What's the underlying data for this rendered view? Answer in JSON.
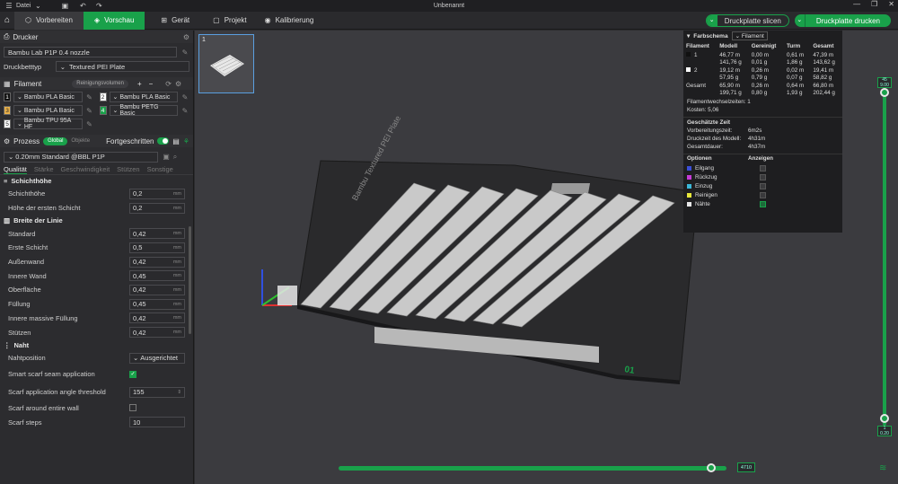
{
  "titlebar": {
    "file_menu": "Datei",
    "title": "Unbenannt"
  },
  "toolbar": {
    "tab_prepare": "Vorbereiten",
    "tab_preview": "Vorschau",
    "device": "Gerät",
    "project": "Projekt",
    "calibration": "Kalibrierung",
    "slice_plate": "Druckplatte slicen",
    "print_plate": "Druckplatte drucken"
  },
  "printer": {
    "section": "Drucker",
    "name": "Bambu Lab P1P 0.4 nozzle",
    "bed_label": "Druckbetttyp",
    "bed_value": "Textured PEI Plate"
  },
  "filament": {
    "section": "Filament",
    "cleaning_volume": "Reinigungsvolumen",
    "items": [
      {
        "num": "1",
        "name": "Bambu PLA Basic",
        "color": "#111111"
      },
      {
        "num": "2",
        "name": "Bambu PLA Basic",
        "color": "#ffffff"
      },
      {
        "num": "3",
        "name": "Bambu PLA Basic",
        "color": "#e8b04a"
      },
      {
        "num": "4",
        "name": "Bambu PETG Basic",
        "color": "#19a14a"
      },
      {
        "num": "5",
        "name": "Bambu TPU 95A HF",
        "color": "#ffffff"
      }
    ]
  },
  "process": {
    "section": "Prozess",
    "toggle_global": "Global",
    "toggle_objects": "Objekte",
    "advanced": "Fortgeschritten",
    "preset": "0.20mm Standard @BBL P1P",
    "tabs": [
      "Qualität",
      "Stärke",
      "Geschwindigkeit",
      "Stützen",
      "Sonstige"
    ],
    "group_layer": "Schichthöhe",
    "layer_params": [
      {
        "label": "Schichthöhe",
        "value": "0,2",
        "unit": "mm"
      },
      {
        "label": "Höhe der ersten Schicht",
        "value": "0,2",
        "unit": "mm"
      }
    ],
    "group_width": "Breite der Linie",
    "width_params": [
      {
        "label": "Standard",
        "value": "0,42",
        "unit": "mm"
      },
      {
        "label": "Erste Schicht",
        "value": "0,5",
        "unit": "mm"
      },
      {
        "label": "Außenwand",
        "value": "0,42",
        "unit": "mm"
      },
      {
        "label": "Innere Wand",
        "value": "0,45",
        "unit": "mm"
      },
      {
        "label": "Oberfläche",
        "value": "0,42",
        "unit": "mm"
      },
      {
        "label": "Füllung",
        "value": "0,45",
        "unit": "mm"
      },
      {
        "label": "Innere massive Füllung",
        "value": "0,42",
        "unit": "mm"
      },
      {
        "label": "Stützen",
        "value": "0,42",
        "unit": "mm"
      }
    ],
    "group_seam": "Naht",
    "seam_position_label": "Nahtposition",
    "seam_position_value": "Ausgerichtet",
    "smart_scarf_label": "Smart scarf seam application",
    "scarf_angle_label": "Scarf application angle threshold",
    "scarf_angle_value": "155",
    "scarf_wall_label": "Scarf around entire wall",
    "scarf_steps_label": "Scarf steps",
    "scarf_steps_value": "10"
  },
  "plate": {
    "number": "1",
    "corner_label": "01"
  },
  "stats": {
    "color_scheme_label": "Farbschema",
    "color_scheme_value": "Filament",
    "headers": [
      "Filament",
      "Modell",
      "Gereinigt",
      "Turm",
      "Gesamt"
    ],
    "rows": [
      {
        "id": "1",
        "color": "#111111",
        "modell": [
          "46,77 m",
          "141,76 g"
        ],
        "gereinigt": [
          "0,00 m",
          "0,01 g"
        ],
        "turm": [
          "0,61 m",
          "1,86 g"
        ],
        "gesamt": [
          "47,39 m",
          "143,62 g"
        ]
      },
      {
        "id": "2",
        "color": "#ffffff",
        "modell": [
          "19,12 m",
          "57,95 g"
        ],
        "gereinigt": [
          "0,26 m",
          "0,79 g"
        ],
        "turm": [
          "0,02 m",
          "0,07 g"
        ],
        "gesamt": [
          "19,41 m",
          "58,82 g"
        ]
      }
    ],
    "total": {
      "label": "Gesamt",
      "modell": [
        "65,90 m",
        "199,71 g"
      ],
      "gereinigt": [
        "0,26 m",
        "0,80 g"
      ],
      "turm": [
        "0,64 m",
        "1,93 g"
      ],
      "gesamt": [
        "66,80 m",
        "202,44 g"
      ]
    },
    "changes_label": "Filamentwechselzeiten:",
    "changes_value": "1",
    "cost_label": "Kosten:",
    "cost_value": "5,06",
    "time_head": "Geschätzte Zeit",
    "prep_label": "Vorbereitungszeit:",
    "prep_value": "6m2s",
    "model_label": "Druckzeit des Modell:",
    "model_value": "4h31m",
    "total_label": "Gesamtdauer:",
    "total_value": "4h37m",
    "options_head": "Optionen",
    "show_head": "Anzeigen",
    "options": [
      {
        "label": "Eilgang",
        "color": "#3b4fd8",
        "on": false
      },
      {
        "label": "Rückzug",
        "color": "#c63bd8",
        "on": false
      },
      {
        "label": "Einzug",
        "color": "#3bb8d8",
        "on": false
      },
      {
        "label": "Reinigen",
        "color": "#e8e83b",
        "on": false
      },
      {
        "label": "Nähte",
        "color": "#e8e8e8",
        "on": true
      }
    ]
  },
  "layers": {
    "top_num": "45",
    "top_height": "9.00",
    "bottom_num": "1",
    "bottom_height": "0.20",
    "progress_label": "4710",
    "progress": 0.96
  }
}
